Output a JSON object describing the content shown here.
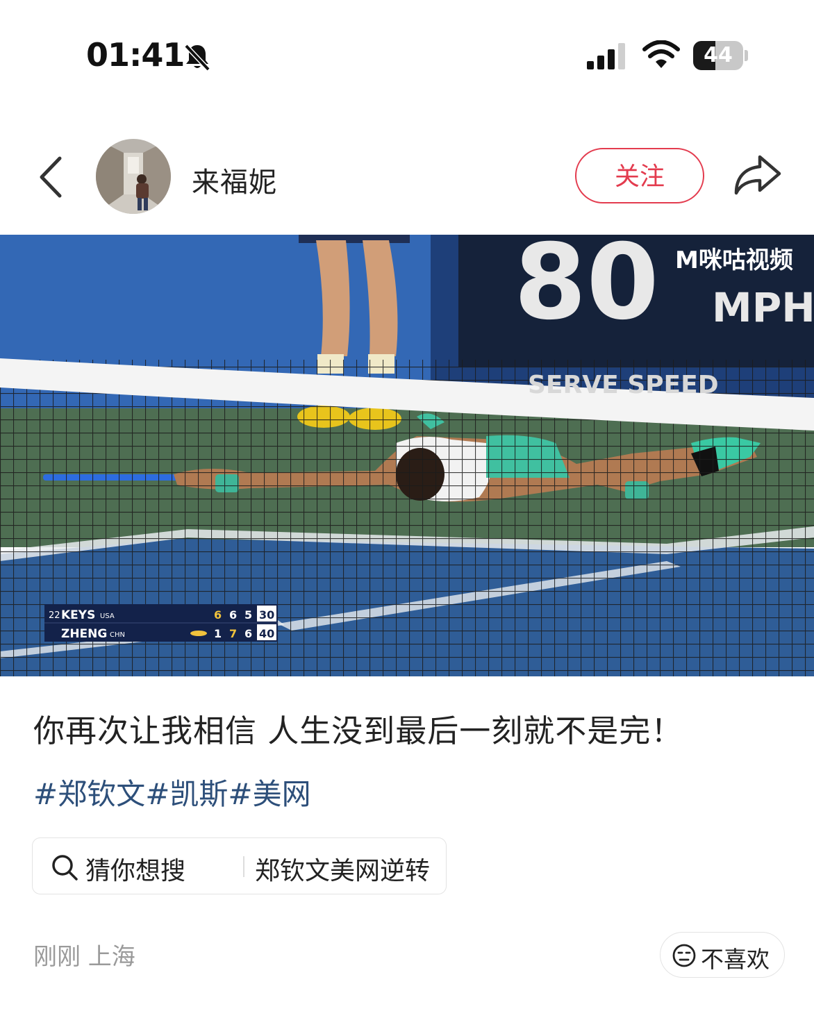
{
  "status_bar": {
    "time": "01:41",
    "battery_percent": "44",
    "battery_level": 0.44,
    "icons": [
      "bell-slash-icon",
      "cellular-signal-icon",
      "wifi-icon",
      "battery-icon"
    ]
  },
  "header": {
    "back_icon": "chevron-left-icon",
    "username": "来福妮",
    "follow_label": "关注",
    "share_icon": "share-arrow-icon",
    "accent_color": "#e33b4e"
  },
  "media": {
    "watermark": "M咪咕视频",
    "speed_value": "80",
    "speed_unit": "MPH",
    "speed_caption": "SERVE SPEED",
    "scoreboard": [
      {
        "seed": "22",
        "name": "KEYS",
        "country": "USA",
        "sets": [
          "6",
          "6",
          "5"
        ],
        "points": "30",
        "serving": false
      },
      {
        "seed": "",
        "name": "ZHENG",
        "country": "CHN",
        "sets": [
          "1",
          "7",
          "6"
        ],
        "points": "40",
        "serving": true
      }
    ]
  },
  "post": {
    "caption": "你再次让我相信 人生没到最后一刻就不是完！",
    "tags": [
      "#郑钦文",
      "#凯斯",
      "#美网"
    ],
    "tag_color": "#2d4f7a"
  },
  "suggestion": {
    "icon": "search-icon",
    "label": "猜你想搜",
    "query": "郑钦文美网逆转"
  },
  "footer": {
    "time_location": "刚刚 上海",
    "dislike_icon": "meh-face-icon",
    "dislike_label": "不喜欢"
  }
}
